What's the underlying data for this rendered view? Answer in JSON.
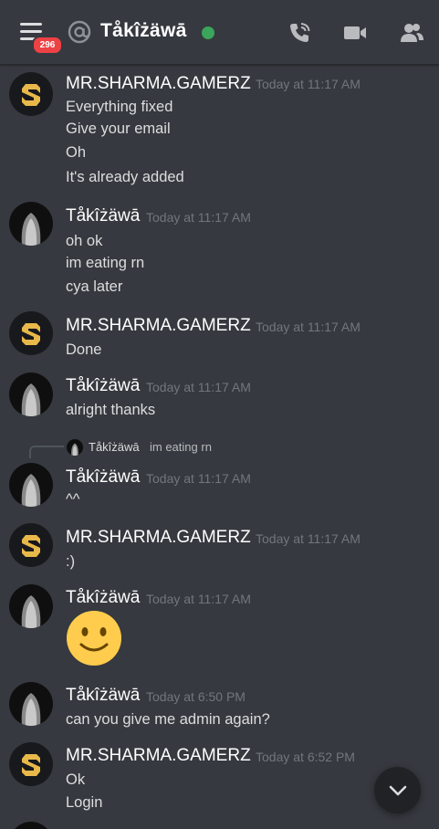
{
  "header": {
    "menu_badge": "296",
    "channel_name": "Tåkîżäwā",
    "colors": {
      "online": "#3ba55c",
      "badge": "#ed4245"
    },
    "icons": [
      "menu-icon",
      "at-icon",
      "voice-call-icon",
      "video-call-icon",
      "members-icon"
    ]
  },
  "messages": [
    {
      "author": "MR.SHARMA.GAMERZ",
      "time": "Today at 11:17 AM",
      "lines": [
        "Everything fixed",
        "Give your email",
        "Oh",
        "It's already added"
      ]
    },
    {
      "author": "Tåkîżäwā",
      "time": "Today at 11:17 AM",
      "lines": [
        "oh ok",
        "im eating rn",
        "cya later"
      ]
    },
    {
      "author": "MR.SHARMA.GAMERZ",
      "time": "Today at 11:17 AM",
      "lines": [
        "Done"
      ]
    },
    {
      "author": "Tåkîżäwā",
      "time": "Today at 11:17 AM",
      "lines": [
        "alright thanks"
      ]
    },
    {
      "author": "Tåkîżäwā",
      "time": "Today at 11:17 AM",
      "lines": [
        "^^"
      ],
      "reply": {
        "author": "Tåkîżäwā",
        "text": "im eating rn"
      }
    },
    {
      "author": "MR.SHARMA.GAMERZ",
      "time": "Today at 11:17 AM",
      "lines": [
        ":)"
      ]
    },
    {
      "author": "Tåkîżäwā",
      "time": "Today at 11:17 AM",
      "lines": [],
      "emoji": "slightly-smiling-face-emoji"
    },
    {
      "author": "Tåkîżäwā",
      "time": "Today at 6:50 PM",
      "lines": [
        "can you give me admin again?"
      ]
    },
    {
      "author": "MR.SHARMA.GAMERZ",
      "time": "Today at 6:52 PM",
      "lines": [
        "Ok",
        "Login"
      ]
    }
  ],
  "scroll_button_icon": "chevron-down-icon"
}
